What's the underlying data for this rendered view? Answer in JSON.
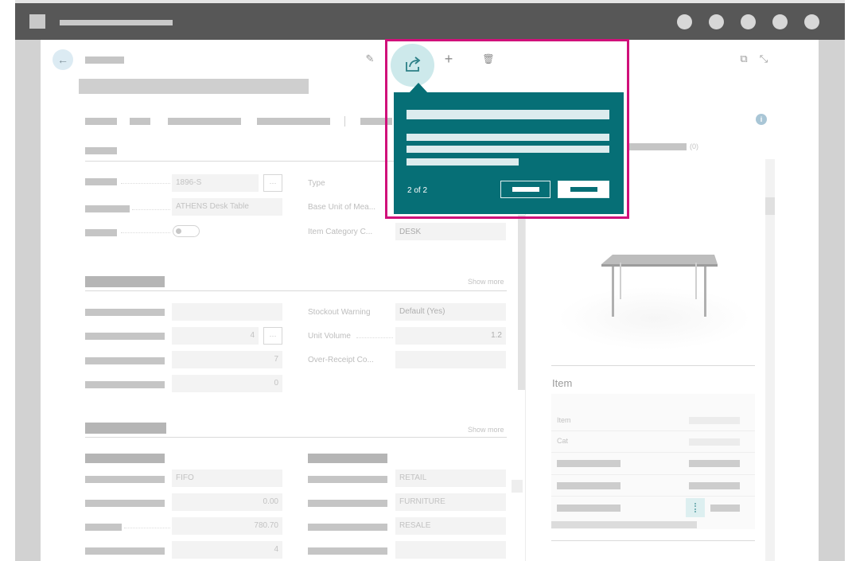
{
  "app": {
    "window_colors": {
      "titlebar": "#575757",
      "accent": "#066f76",
      "highlight": "#d0107a"
    }
  },
  "toolbar": {
    "back_icon": "arrow-left-icon",
    "edit_icon": "pencil-icon",
    "share_icon": "share-icon",
    "new_icon": "plus-icon",
    "delete_icon": "trash-icon",
    "open_new_window_icon": "open-in-new-icon",
    "collapse_icon": "collapse-icon",
    "new_glyph": "+",
    "edit_glyph": "✎",
    "delete_glyph": "🗑",
    "open_glyph": "⧉",
    "collapse_glyph": "⤡"
  },
  "general": {
    "no_value": "1896-S",
    "description_value": "ATHENS Desk Table",
    "type_label": "Type",
    "base_unit_label": "Base Unit of Mea...",
    "item_category_label": "Item Category C...",
    "item_category_value": "DESK",
    "more_glyph": "···"
  },
  "inventory": {
    "show_more": "Show more",
    "stockout_label": "Stockout Warning",
    "stockout_value": "Default (Yes)",
    "unit_volume_label": "Unit Volume",
    "unit_volume_value": "1.2",
    "over_receipt_label": "Over-Receipt Co...",
    "field_values": [
      "4",
      "7",
      "0"
    ],
    "more_glyph": "···"
  },
  "costs": {
    "show_more": "Show more",
    "costing_method_value": "FIFO",
    "unit_cost_value": "0.00",
    "unit_price_value": "780.70",
    "profit_value": "4",
    "right_values": [
      "RETAIL",
      "FURNITURE",
      "RESALE"
    ]
  },
  "factbox": {
    "info_glyph": "i",
    "count": "(0)",
    "section_title": "Item",
    "rows": [
      "Item",
      "Cat"
    ],
    "picture_alt": "desk-table-picture"
  },
  "tour_popup": {
    "step": "2 of 2"
  }
}
